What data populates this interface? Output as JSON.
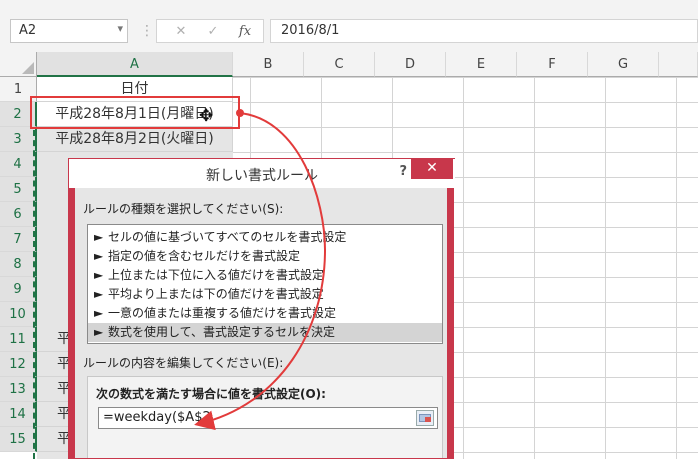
{
  "formula_bar": {
    "name_box": "A2",
    "name_box_dropdown": "▾",
    "dots": "⋮",
    "cancel_glyph": "✕",
    "enter_glyph": "✓",
    "fx_glyph": "fx",
    "formula_text": "2016/8/1"
  },
  "columns": [
    "A",
    "B",
    "C",
    "D",
    "E",
    "F",
    "G"
  ],
  "rows": [
    "1",
    "2",
    "3",
    "4",
    "5",
    "6",
    "7",
    "8",
    "9",
    "10",
    "11",
    "12",
    "13",
    "14",
    "15"
  ],
  "cells": {
    "A1": "日付",
    "A2": "平成28年8月1日(月曜日)",
    "A3": "平成28年8月2日(火曜日)",
    "A11": "平",
    "A12": "平",
    "A13": "平",
    "A14": "平",
    "A15": "平"
  },
  "dialog": {
    "title": "新しい書式ルール",
    "help_glyph": "?",
    "close_glyph": "✕",
    "rule_type_label": "ルールの種類を選択してください(S):",
    "rule_types": [
      "セルの値に基づいてすべてのセルを書式設定",
      "指定の値を含むセルだけを書式設定",
      "上位または下位に入る値だけを書式設定",
      "平均より上または下の値だけを書式設定",
      "一意の値または重複する値だけを書式設定",
      "数式を使用して、書式設定するセルを決定"
    ],
    "rule_type_selected_index": 5,
    "rule_arrow_glyph": "►",
    "edit_label": "ルールの内容を編集してください(E):",
    "formula_condition_label": "次の数式を満たす場合に値を書式設定(O):",
    "formula_value": "=weekday($A$2"
  },
  "colors": {
    "selection_green": "#217346",
    "annotation_red": "#e23b3b",
    "dialog_accent": "#c8374b"
  },
  "icons": {
    "cursor": "cross-cursor-icon",
    "collapse": "collapse-dialog-icon"
  }
}
